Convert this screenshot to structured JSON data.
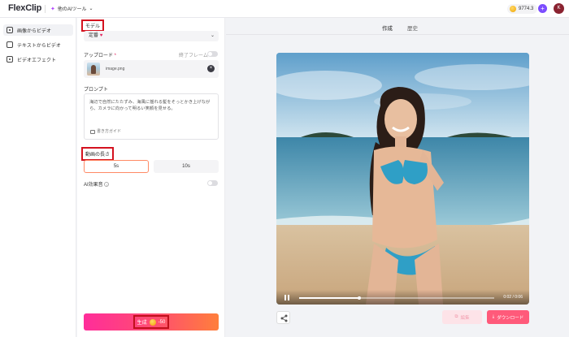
{
  "app": {
    "logo": "FlexClip",
    "tools_menu": "他のAIツール"
  },
  "header": {
    "credits": "9774.3",
    "avatar_initial": "K"
  },
  "nav": {
    "items": [
      {
        "label": "画像からビデオ",
        "icon": "image-video-icon"
      },
      {
        "label": "テキストからビデオ",
        "icon": "text-video-icon"
      },
      {
        "label": "ビデオエフェクト",
        "icon": "video-effect-icon"
      }
    ]
  },
  "panel": {
    "model_label": "モデル",
    "model_value": "定番",
    "upload_label": "アップロード",
    "end_frame_label": "終了フレーム",
    "upload_file": "image.png",
    "prompt_label": "プロンプト",
    "prompt_text": "海辺で自然にたたずみ、海風に揺れる髪をそっとかき上げながら、カメラに向かって明るい笑顔を見せる。",
    "prompt_guide": "書き方ガイド",
    "duration_label": "動画の長さ",
    "duration_options": [
      "5s",
      "10s"
    ],
    "duration_selected": "5s",
    "ai_sound_label": "AI効果音",
    "generate_label": "生成",
    "generate_cost": "-50"
  },
  "preview": {
    "tabs": [
      "作成",
      "歴史"
    ],
    "active_tab": "作成",
    "video_time": "0:02 / 0:06",
    "video_progress": 0.31,
    "edit_label": "編集",
    "download_label": "ダウンロード"
  },
  "colors": {
    "accent_gradient_start": "#ff2d9a",
    "accent_gradient_end": "#ff7f3b",
    "download": "#ff5a7a",
    "highlight": "#d4121f"
  }
}
